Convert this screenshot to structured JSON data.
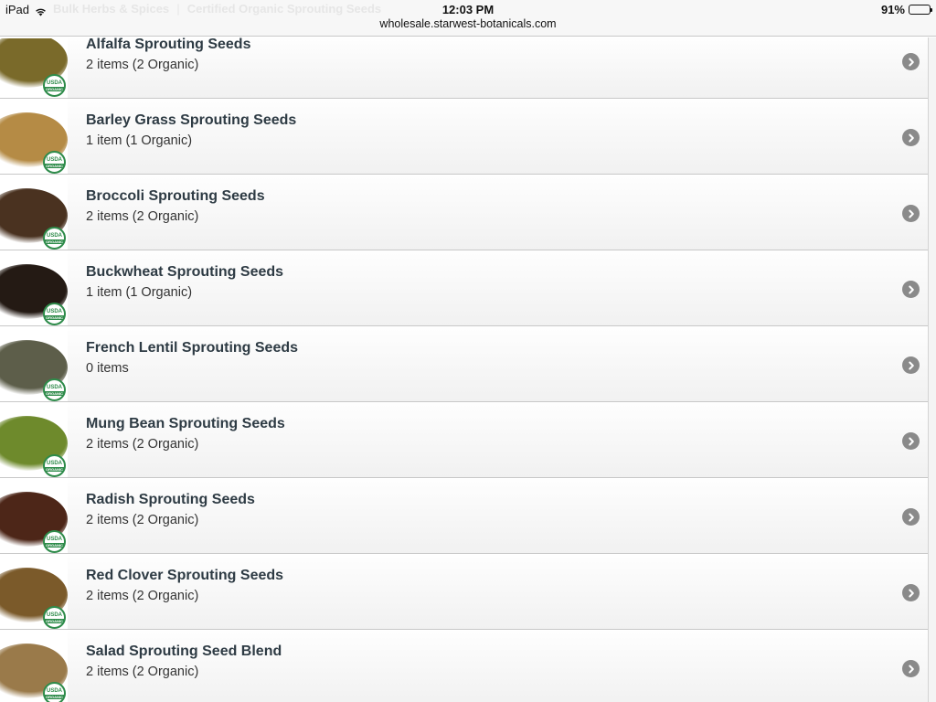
{
  "status": {
    "device": "iPad",
    "time": "12:03 PM",
    "url": "wholesale.starwest-botanicals.com",
    "battery": "91%",
    "battery_level": 0.91
  },
  "breadcrumb": {
    "parent": "Bulk Herbs & Spices",
    "current": "Certified Organic Sprouting Seeds"
  },
  "colors": {
    "title": "#2e3b44",
    "usda_green": "#2e8b4a",
    "arrow": "#8a8a8a"
  },
  "items": [
    {
      "title": "Alfalfa Sprouting Seeds",
      "sub": "2 items (2 Organic)",
      "color": "#7a6a2a",
      "organic": true
    },
    {
      "title": "Barley Grass Sprouting Seeds",
      "sub": "1 item (1 Organic)",
      "color": "#b58b45",
      "organic": true
    },
    {
      "title": "Broccoli Sprouting Seeds",
      "sub": "2 items (2 Organic)",
      "color": "#4a3220",
      "organic": true
    },
    {
      "title": "Buckwheat Sprouting Seeds",
      "sub": "1 item (1 Organic)",
      "color": "#241a14",
      "organic": true
    },
    {
      "title": "French Lentil Sprouting Seeds",
      "sub": "0 items",
      "color": "#5d5e4a",
      "organic": true
    },
    {
      "title": "Mung Bean Sprouting Seeds",
      "sub": "2 items (2 Organic)",
      "color": "#6e8a2c",
      "organic": true
    },
    {
      "title": "Radish Sprouting Seeds",
      "sub": "2 items (2 Organic)",
      "color": "#4d2618",
      "organic": true
    },
    {
      "title": "Red Clover Sprouting Seeds",
      "sub": "2 items (2 Organic)",
      "color": "#7b5a2a",
      "organic": true
    },
    {
      "title": "Salad Sprouting Seed Blend",
      "sub": "2 items (2 Organic)",
      "color": "#9a7a4a",
      "organic": true
    }
  ],
  "badge": {
    "top": "USDA",
    "bottom": "ORGANIC"
  }
}
